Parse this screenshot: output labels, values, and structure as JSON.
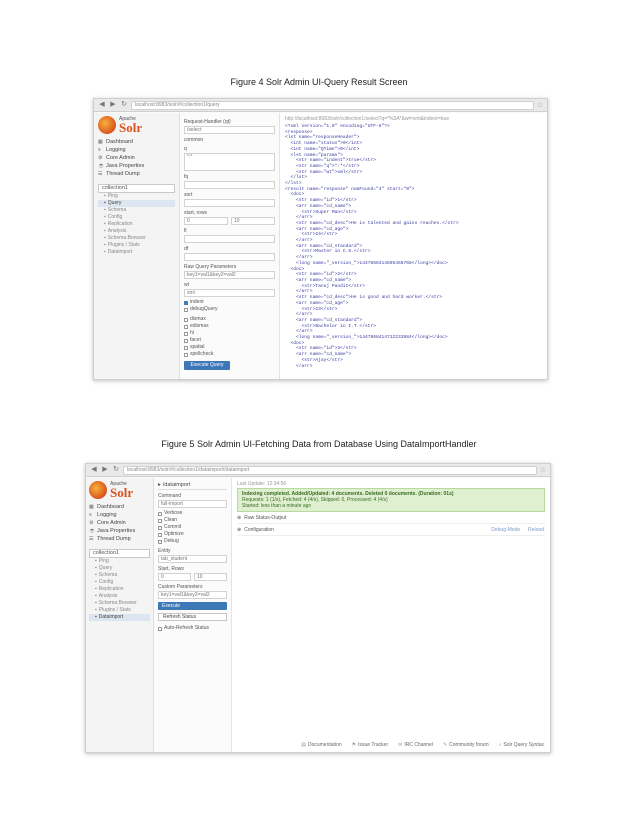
{
  "captions": {
    "fig4": "Figure 4 Solr Admin UI-Query Result Screen",
    "fig5": "Figure 5 Solr Admin UI-Fetching Data from Database Using DataImportHandler"
  },
  "colors": {
    "solr_orange": "#d9541e",
    "button_blue": "#3e77b8",
    "success_green": "#dff0d0"
  },
  "shot1": {
    "url": "localhost:8983/solr/#/collection1/query",
    "logo": {
      "small": "Apache",
      "big": "Solr"
    },
    "menu": [
      {
        "icon": "dashboard-icon",
        "glyph": "▦",
        "label": "Dashboard"
      },
      {
        "icon": "logging-icon",
        "glyph": "≡",
        "label": "Logging"
      },
      {
        "icon": "core-admin-icon",
        "glyph": "⚙",
        "label": "Core Admin"
      },
      {
        "icon": "java-properties-icon",
        "glyph": "☕",
        "label": "Java Properties"
      },
      {
        "icon": "thread-dump-icon",
        "glyph": "☰",
        "label": "Thread Dump"
      }
    ],
    "core": "collection1",
    "sub_menu": [
      "Ping",
      "Query",
      "Schema",
      "Config",
      "Replication",
      "Analysis",
      "Schema Browser",
      "Plugins / Stats",
      "Dataimport"
    ],
    "form": {
      "handler_label": "Request-Handler (qt)",
      "handler_value": "/select",
      "common": "common",
      "q_label": "q",
      "q_value": "*:*",
      "fq_label": "fq",
      "sort_label": "sort",
      "start_rows_label": "start, rows",
      "start_value": "0",
      "rows_value": "10",
      "fl_label": "fl",
      "df_label": "df",
      "raw_label": "Raw Query Parameters",
      "raw_placeholder": "key1=val1&key2=val2",
      "wt_label": "wt",
      "wt_value": "xml",
      "checkboxes": [
        {
          "label": "indent",
          "on": true
        },
        {
          "label": "debugQuery",
          "on": false
        },
        {
          "label": "dismax",
          "on": false
        },
        {
          "label": "edismax",
          "on": false
        },
        {
          "label": "hl",
          "on": false
        },
        {
          "label": "facet",
          "on": false
        },
        {
          "label": "spatial",
          "on": false
        },
        {
          "label": "spellcheck",
          "on": false
        }
      ],
      "execute": "Execute Query"
    },
    "result_url": "http://localhost:8983/solr/collection1/select?q=*%3A*&wt=xml&indent=true",
    "xml": [
      "<?xml version=\"1.0\" encoding=\"UTF-8\"?>",
      "<response>",
      "",
      "<lst name=\"responseHeader\">",
      "  <int name=\"status\">0</int>",
      "  <int name=\"QTime\">0</int>",
      "  <lst name=\"params\">",
      "    <str name=\"indent\">true</str>",
      "    <str name=\"q\">*:*</str>",
      "    <str name=\"wt\">xml</str>",
      "  </lst>",
      "</lst>",
      "<result name=\"response\" numFound=\"4\" start=\"0\">",
      "  <doc>",
      "    <str name=\"id\">1</str>",
      "    <arr name=\"cd_name\">",
      "      <str>Super Man</str>",
      "    </arr>",
      "    <str name=\"cd_desc\">He is talented and gains reaches.</str>",
      "    <arr name=\"cd_age\">",
      "      <str>24</str>",
      "    </arr>",
      "    <arr name=\"cd_standard\">",
      "      <str>Master in C.S.</str>",
      "    </arr>",
      "    <long name=\"_version_\">1447868414695456768</long></doc>",
      "  <doc>",
      "    <str name=\"id\">2</str>",
      "    <arr name=\"cd_name\">",
      "      <str>Tanuj Pandit</str>",
      "    </arr>",
      "    <str name=\"cd_desc\">He is good and hard worker.</str>",
      "    <arr name=\"cd_age\">",
      "      <str>23</str>",
      "    </arr>",
      "    <arr name=\"cd_standard\">",
      "      <str>Bachelor in I.T.</str>",
      "    </arr>",
      "    <long name=\"_version_\">1447868414712233984</long></doc>",
      "  <doc>",
      "    <str name=\"id\">3</str>",
      "    <arr name=\"cd_name\">",
      "      <str>Ajay</str>",
      "    </arr>"
    ]
  },
  "shot2": {
    "url": "localhost:8983/solr/#/collection1/dataimport//dataimport",
    "logo": {
      "small": "Apache",
      "big": "Solr"
    },
    "menu": [
      {
        "icon": "dashboard-icon",
        "glyph": "▦",
        "label": "Dashboard"
      },
      {
        "icon": "logging-icon",
        "glyph": "≡",
        "label": "Logging"
      },
      {
        "icon": "core-admin-icon",
        "glyph": "⚙",
        "label": "Core Admin"
      },
      {
        "icon": "java-properties-icon",
        "glyph": "☕",
        "label": "Java Properties"
      },
      {
        "icon": "thread-dump-icon",
        "glyph": "☰",
        "label": "Thread Dump"
      }
    ],
    "core": "collection1",
    "sub_menu": [
      "Ping",
      "Query",
      "Schema",
      "Config",
      "Replication",
      "Analysis",
      "Schema Browser",
      "Plugins / Stats",
      "Dataimport"
    ],
    "di_head": "/dataimport",
    "command_label": "Command",
    "command_value": "full-import",
    "options": [
      "Verbose",
      "Clean",
      "Commit",
      "Optimize",
      "Debug"
    ],
    "entity_label": "Entity",
    "entity_value": "tab_student",
    "start_rows_label": "Start, Rows",
    "start_value": "0",
    "rows_value": "10",
    "custom_label": "Custom Parameters",
    "custom_placeholder": "key1=val1&key2=val2",
    "execute": "Execute",
    "refresh": "Refresh Status",
    "auto_refresh": "Auto-Refresh Status",
    "last_update": "Last Update: 12:34:56",
    "status": [
      "Indexing completed. Added/Updated: 4 documents. Deleted 0 documents. (Duration: 01s)",
      "Requests: 1 (1/s), Fetched: 4 (4/s), Skipped: 0, Processed: 4 (4/s)",
      "Started: less than a minute ago"
    ],
    "raw_status": "Raw Status-Output",
    "configuration": "Configuration",
    "debug_mode": "Debug-Mode",
    "reload": "Reload",
    "footer": [
      {
        "icon": "documentation-icon",
        "glyph": "▤",
        "label": "Documentation"
      },
      {
        "icon": "issue-tracker-icon",
        "glyph": "⚑",
        "label": "Issue Tracker"
      },
      {
        "icon": "irc-channel-icon",
        "glyph": "✉",
        "label": "IRC Channel"
      },
      {
        "icon": "community-forum-icon",
        "glyph": "✎",
        "label": "Community forum"
      },
      {
        "icon": "solr-query-syntax-icon",
        "glyph": "⌕",
        "label": "Solr Query Syntax"
      }
    ]
  }
}
